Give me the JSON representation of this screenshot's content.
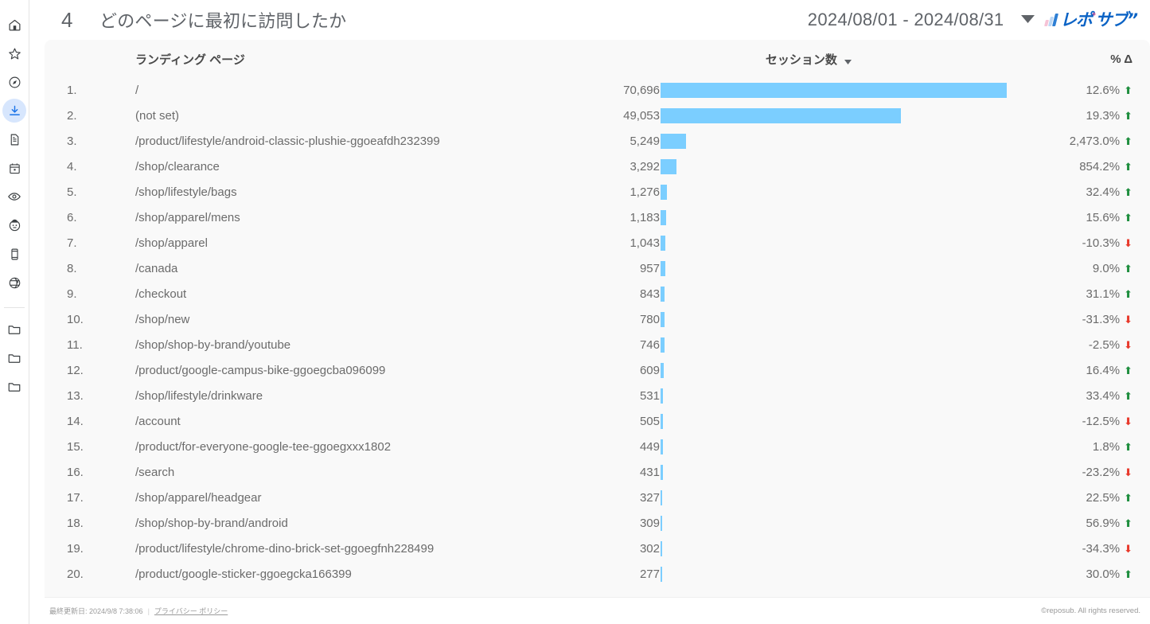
{
  "sidebar": {
    "items": [
      {
        "icon": "home-icon",
        "active": false
      },
      {
        "icon": "star-icon",
        "active": false
      },
      {
        "icon": "compass-icon",
        "active": false
      },
      {
        "icon": "download-icon",
        "active": true
      },
      {
        "icon": "document-icon",
        "active": false
      },
      {
        "icon": "calendar-icon",
        "active": false
      },
      {
        "icon": "eye-icon",
        "active": false
      },
      {
        "icon": "person-icon",
        "active": false
      },
      {
        "icon": "mobile-icon",
        "active": false
      },
      {
        "icon": "globe-icon",
        "active": false
      }
    ],
    "folders": [
      {
        "icon": "folder-icon"
      },
      {
        "icon": "folder-icon"
      },
      {
        "icon": "folder-icon"
      }
    ]
  },
  "header": {
    "page_number": "4",
    "title": "どのページに最初に訪問したか",
    "date_range": "2024/08/01 - 2024/08/31",
    "caret_icon": "chevron-down-icon",
    "logo": {
      "text": "レポ",
      "mark": "°",
      "text2": "サブ",
      "quote": "”",
      "colors": [
        "#f6c3d6",
        "#bcd8f5",
        "#2e7fd4"
      ],
      "brand_color": "#0b63c5",
      "accent_color": "#ef4c8b"
    }
  },
  "table": {
    "headers": {
      "rank": "",
      "page": "ランディング ページ",
      "sessions": "セッション数",
      "sort_icon": "sort-descending-caret",
      "delta": "% Δ"
    },
    "rows": [
      {
        "rank": "1.",
        "page": "/",
        "value": "70,696",
        "raw": 70696,
        "delta": "12.6%",
        "dir": "up"
      },
      {
        "rank": "2.",
        "page": "(not set)",
        "value": "49,053",
        "raw": 49053,
        "delta": "19.3%",
        "dir": "up"
      },
      {
        "rank": "3.",
        "page": "/product/lifestyle/android-classic-plushie-ggoeafdh232399",
        "value": "5,249",
        "raw": 5249,
        "delta": "2,473.0%",
        "dir": "up"
      },
      {
        "rank": "4.",
        "page": "/shop/clearance",
        "value": "3,292",
        "raw": 3292,
        "delta": "854.2%",
        "dir": "up"
      },
      {
        "rank": "5.",
        "page": "/shop/lifestyle/bags",
        "value": "1,276",
        "raw": 1276,
        "delta": "32.4%",
        "dir": "up"
      },
      {
        "rank": "6.",
        "page": "/shop/apparel/mens",
        "value": "1,183",
        "raw": 1183,
        "delta": "15.6%",
        "dir": "up"
      },
      {
        "rank": "7.",
        "page": "/shop/apparel",
        "value": "1,043",
        "raw": 1043,
        "delta": "-10.3%",
        "dir": "down"
      },
      {
        "rank": "8.",
        "page": "/canada",
        "value": "957",
        "raw": 957,
        "delta": "9.0%",
        "dir": "up"
      },
      {
        "rank": "9.",
        "page": "/checkout",
        "value": "843",
        "raw": 843,
        "delta": "31.1%",
        "dir": "up"
      },
      {
        "rank": "10.",
        "page": "/shop/new",
        "value": "780",
        "raw": 780,
        "delta": "-31.3%",
        "dir": "down"
      },
      {
        "rank": "11.",
        "page": "/shop/shop-by-brand/youtube",
        "value": "746",
        "raw": 746,
        "delta": "-2.5%",
        "dir": "down"
      },
      {
        "rank": "12.",
        "page": "/product/google-campus-bike-ggoegcba096099",
        "value": "609",
        "raw": 609,
        "delta": "16.4%",
        "dir": "up"
      },
      {
        "rank": "13.",
        "page": "/shop/lifestyle/drinkware",
        "value": "531",
        "raw": 531,
        "delta": "33.4%",
        "dir": "up"
      },
      {
        "rank": "14.",
        "page": "/account",
        "value": "505",
        "raw": 505,
        "delta": "-12.5%",
        "dir": "down"
      },
      {
        "rank": "15.",
        "page": "/product/for-everyone-google-tee-ggoegxxx1802",
        "value": "449",
        "raw": 449,
        "delta": "1.8%",
        "dir": "up"
      },
      {
        "rank": "16.",
        "page": "/search",
        "value": "431",
        "raw": 431,
        "delta": "-23.2%",
        "dir": "down"
      },
      {
        "rank": "17.",
        "page": "/shop/apparel/headgear",
        "value": "327",
        "raw": 327,
        "delta": "22.5%",
        "dir": "up"
      },
      {
        "rank": "18.",
        "page": "/shop/shop-by-brand/android",
        "value": "309",
        "raw": 309,
        "delta": "56.9%",
        "dir": "up"
      },
      {
        "rank": "19.",
        "page": "/product/lifestyle/chrome-dino-brick-set-ggoegfnh228499",
        "value": "302",
        "raw": 302,
        "delta": "-34.3%",
        "dir": "down"
      },
      {
        "rank": "20.",
        "page": "/product/google-sticker-ggoegcka166399",
        "value": "277",
        "raw": 277,
        "delta": "30.0%",
        "dir": "up"
      }
    ]
  },
  "chart_data": {
    "type": "bar",
    "title": "どのページに最初に訪問したか",
    "xlabel": "セッション数",
    "ylabel": "ランディング ページ",
    "categories": [
      "/",
      "(not set)",
      "/product/lifestyle/android-classic-plushie-ggoeafdh232399",
      "/shop/clearance",
      "/shop/lifestyle/bags",
      "/shop/apparel/mens",
      "/shop/apparel",
      "/canada",
      "/checkout",
      "/shop/new",
      "/shop/shop-by-brand/youtube",
      "/product/google-campus-bike-ggoegcba096099",
      "/shop/lifestyle/drinkware",
      "/account",
      "/product/for-everyone-google-tee-ggoegxxx1802",
      "/search",
      "/shop/apparel/headgear",
      "/shop/shop-by-brand/android",
      "/product/lifestyle/chrome-dino-brick-set-ggoegfnh228499",
      "/product/google-sticker-ggoegcka166399"
    ],
    "values": [
      70696,
      49053,
      5249,
      3292,
      1276,
      1183,
      1043,
      957,
      843,
      780,
      746,
      609,
      531,
      505,
      449,
      431,
      327,
      309,
      302,
      277
    ],
    "delta_pct": [
      12.6,
      19.3,
      2473.0,
      854.2,
      32.4,
      15.6,
      -10.3,
      9.0,
      31.1,
      -31.3,
      -2.5,
      16.4,
      33.4,
      -12.5,
      1.8,
      -23.2,
      22.5,
      56.9,
      -34.3,
      30.0
    ],
    "xlim": [
      0,
      70696
    ],
    "grid": false,
    "legend": "none",
    "bar_color": "#7bceff",
    "sorted_by": "セッション数",
    "sort_order": "descending"
  },
  "footer": {
    "updated_label": "最終更新日: 2024/9/8 7:38:06",
    "separator": "|",
    "privacy_link": "プライバシー ポリシー",
    "copyright": "©reposub. All rights reserved."
  },
  "colors": {
    "bar": "#7bceff",
    "up": "#1e8e3e",
    "down": "#e8392b",
    "active_sidebar_bg": "#d7e6fd",
    "active_sidebar_fg": "#1a73e8",
    "card_bg": "#f9f9f9",
    "text": "#6b6b6b"
  }
}
